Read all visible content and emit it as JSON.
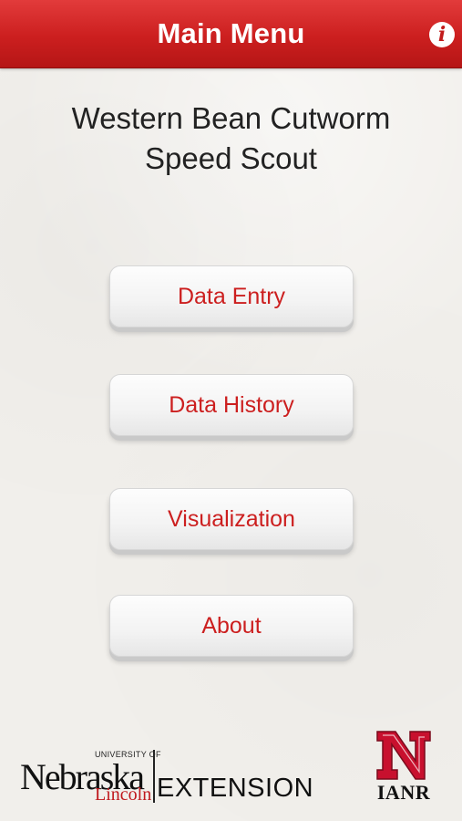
{
  "header": {
    "title": "Main Menu",
    "info_glyph": "i",
    "info_icon": "info-icon",
    "bar_color": "#cc1f1f"
  },
  "app": {
    "title_line1": "Western Bean Cutworm",
    "title_line2": "Speed Scout"
  },
  "menu": {
    "items": [
      {
        "label": "Data Entry"
      },
      {
        "label": "Data History"
      },
      {
        "label": "Visualization"
      },
      {
        "label": "About"
      }
    ],
    "text_color": "#cc1f1f"
  },
  "footer": {
    "unl": {
      "university_of": "UNIVERSITY OF",
      "nebraska": "Nebraska",
      "lincoln": "Lincoln",
      "extension": "EXTENSION"
    },
    "ianr": {
      "text": "IANR"
    }
  }
}
